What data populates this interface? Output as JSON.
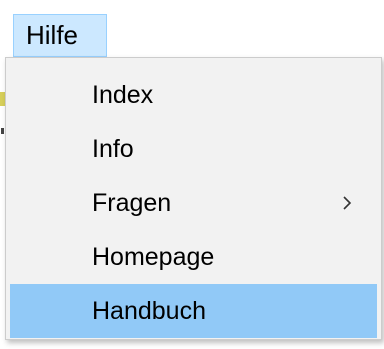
{
  "menubar": {
    "active_menu_label": "Hilfe"
  },
  "menu": {
    "items": [
      {
        "label": "Index",
        "has_submenu": false,
        "highlighted": false
      },
      {
        "label": "Info",
        "has_submenu": false,
        "highlighted": false
      },
      {
        "label": "Fragen",
        "has_submenu": true,
        "highlighted": false,
        "submenu_icon": "chevron-right-icon"
      },
      {
        "label": "Homepage",
        "has_submenu": false,
        "highlighted": false
      },
      {
        "label": "Handbuch",
        "has_submenu": false,
        "highlighted": true
      }
    ]
  },
  "colors": {
    "menubar_active_bg": "#cce8ff",
    "menu_bg": "#f2f2f2",
    "highlight_bg": "#91c9f7"
  }
}
